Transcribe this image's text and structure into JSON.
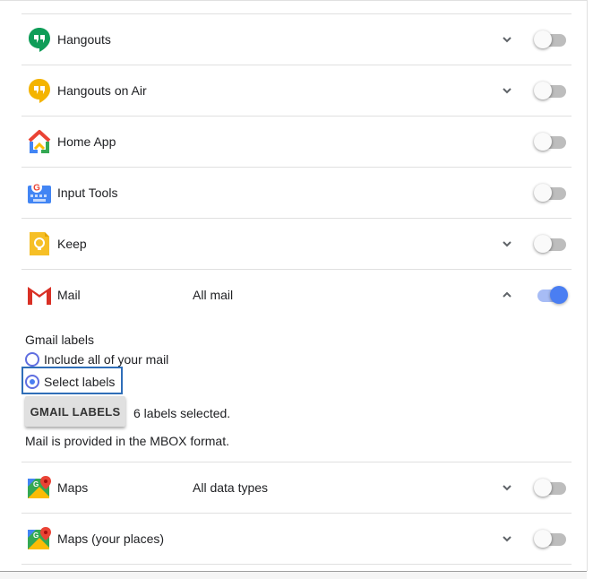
{
  "products": [
    {
      "name": "Hangouts",
      "detail": "",
      "icon": "hangouts-icon",
      "has_chevron": true,
      "chevron": "down",
      "enabled": false
    },
    {
      "name": "Hangouts on Air",
      "detail": "",
      "icon": "hangouts-on-air-icon",
      "has_chevron": true,
      "chevron": "down",
      "enabled": false
    },
    {
      "name": "Home App",
      "detail": "",
      "icon": "home-app-icon",
      "has_chevron": false,
      "enabled": false
    },
    {
      "name": "Input Tools",
      "detail": "",
      "icon": "input-tools-icon",
      "has_chevron": false,
      "enabled": false
    },
    {
      "name": "Keep",
      "detail": "",
      "icon": "keep-icon",
      "has_chevron": true,
      "chevron": "down",
      "enabled": false
    },
    {
      "name": "Mail",
      "detail": "All mail",
      "icon": "gmail-icon",
      "has_chevron": true,
      "chevron": "up",
      "enabled": true
    },
    {
      "name": "Maps",
      "detail": "All data types",
      "icon": "maps-icon",
      "has_chevron": true,
      "chevron": "down",
      "enabled": false
    },
    {
      "name": "Maps (your places)",
      "detail": "",
      "icon": "maps-icon",
      "has_chevron": true,
      "chevron": "down",
      "enabled": false
    }
  ],
  "mail_options": {
    "section_title": "Gmail labels",
    "radio_all": "Include all of your mail",
    "radio_select": "Select labels",
    "selected_option": "select",
    "button_label": "GMAIL LABELS",
    "labels_selected": "6 labels selected.",
    "format_note": "Mail is provided in the MBOX format."
  },
  "colors": {
    "toggle_on": "#4a7ef2",
    "toggle_off_track": "#bdbdbd",
    "focus_outline": "#2f6eb8"
  }
}
